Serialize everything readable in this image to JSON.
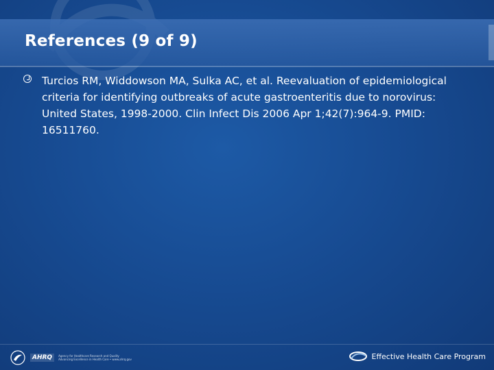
{
  "slide": {
    "title": "References (9 of 9)",
    "bullets": [
      {
        "icon": "clock-bullet-icon",
        "text": "Turcios RM, Widdowson MA, Sulka AC, et al. Reevaluation of epidemiological criteria for identifying outbreaks of acute gastroenteritis due to norovirus: United States, 1998-2000. Clin Infect Dis 2006 Apr 1;42(7):964-9. PMID: 16511760."
      }
    ]
  },
  "footer": {
    "left_logo": "hhs-eagle-logo",
    "agency_mark": "AHRQ",
    "agency_line1": "Agency for Healthcare Research and Quality",
    "agency_line2": "Advancing Excellence in Health Care • www.ahrq.gov",
    "right_logo": "effective-health-care-swoosh-logo",
    "program_name": "Effective Health Care Program"
  },
  "colors": {
    "background": "#174b92",
    "text": "#ffffff"
  }
}
